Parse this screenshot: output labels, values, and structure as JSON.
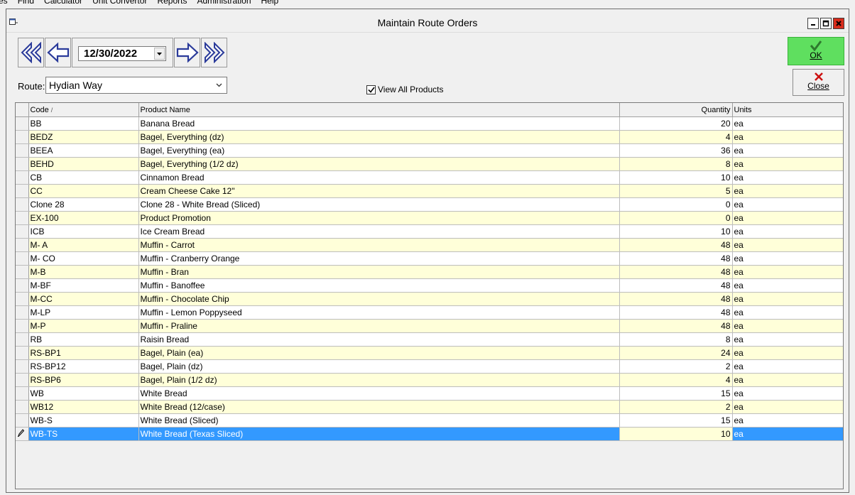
{
  "menubar": [
    "es",
    "Find",
    "Calculator",
    "Unit Convertor",
    "Reports",
    "Administration",
    "Help"
  ],
  "window": {
    "title": "Maintain Route Orders"
  },
  "date_nav": {
    "date": "12/30/2022"
  },
  "route": {
    "label": "Route:",
    "value": "Hydian Way"
  },
  "view_all": {
    "label": "View All Products",
    "checked": true
  },
  "buttons": {
    "ok": "OK",
    "close": "Close"
  },
  "grid": {
    "columns": {
      "code": "Code",
      "name": "Product Name",
      "quantity": "Quantity",
      "units": "Units"
    },
    "rows": [
      {
        "code": "BB",
        "name": "Banana Bread",
        "qty": "20",
        "units": "ea"
      },
      {
        "code": "BEDZ",
        "name": "Bagel, Everything (dz)",
        "qty": "4",
        "units": "ea"
      },
      {
        "code": "BEEA",
        "name": "Bagel, Everything (ea)",
        "qty": "36",
        "units": "ea"
      },
      {
        "code": "BEHD",
        "name": "Bagel, Everything (1/2 dz)",
        "qty": "8",
        "units": "ea"
      },
      {
        "code": "CB",
        "name": "Cinnamon Bread",
        "qty": "10",
        "units": "ea"
      },
      {
        "code": "CC",
        "name": "Cream Cheese Cake 12\"",
        "qty": "5",
        "units": "ea"
      },
      {
        "code": "Clone 28",
        "name": "Clone 28 - White Bread (Sliced)",
        "qty": "0",
        "units": "ea"
      },
      {
        "code": "EX-100",
        "name": "Product Promotion",
        "qty": "0",
        "units": "ea"
      },
      {
        "code": "ICB",
        "name": "Ice Cream Bread",
        "qty": "10",
        "units": "ea"
      },
      {
        "code": "M- A",
        "name": "Muffin - Carrot",
        "qty": "48",
        "units": "ea"
      },
      {
        "code": "M- CO",
        "name": "Muffin - Cranberry Orange",
        "qty": "48",
        "units": "ea"
      },
      {
        "code": "M-B",
        "name": "Muffin - Bran",
        "qty": "48",
        "units": "ea"
      },
      {
        "code": "M-BF",
        "name": "Muffin - Banoffee",
        "qty": "48",
        "units": "ea"
      },
      {
        "code": "M-CC",
        "name": "Muffin - Chocolate Chip",
        "qty": "48",
        "units": "ea"
      },
      {
        "code": "M-LP",
        "name": "Muffin - Lemon Poppyseed",
        "qty": "48",
        "units": "ea"
      },
      {
        "code": "M-P",
        "name": "Muffin - Praline",
        "qty": "48",
        "units": "ea"
      },
      {
        "code": "RB",
        "name": "Raisin Bread",
        "qty": "8",
        "units": "ea"
      },
      {
        "code": "RS-BP1",
        "name": "Bagel, Plain (ea)",
        "qty": "24",
        "units": "ea"
      },
      {
        "code": "RS-BP12",
        "name": "Bagel, Plain (dz)",
        "qty": "2",
        "units": "ea"
      },
      {
        "code": "RS-BP6",
        "name": "Bagel, Plain (1/2 dz)",
        "qty": "4",
        "units": "ea"
      },
      {
        "code": "WB",
        "name": "White Bread",
        "qty": "15",
        "units": "ea"
      },
      {
        "code": "WB12",
        "name": "White Bread (12/case)",
        "qty": "2",
        "units": "ea"
      },
      {
        "code": "WB-S",
        "name": "White Bread (Sliced)",
        "qty": "15",
        "units": "ea"
      },
      {
        "code": "WB-TS",
        "name": "White Bread (Texas Sliced)",
        "qty": "10",
        "units": "ea",
        "selected": true
      }
    ]
  },
  "colors": {
    "row_alt": "#ffffd9",
    "selection": "#3399ff",
    "ok_button": "#5fdf5f",
    "nav_arrow": "#2a3a9a"
  }
}
